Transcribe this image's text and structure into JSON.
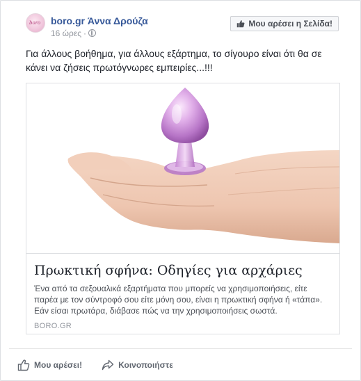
{
  "post": {
    "page_name": "boro.gr Άννα Δρούζα",
    "avatar_text": "boro",
    "time": "16 ώρες",
    "separator": "·",
    "like_page_label": "Μου αρέσει η Σελίδα!",
    "text": "Για άλλους βοήθημα, για άλλους εξάρτημα, το σίγουρο είναι ότι θα σε κάνει να ζήσεις πρωτόγνωρες εμπειρίες...!!!"
  },
  "link": {
    "title": "Πρωκτική σφήνα: Οδηγίες για αρχάριες",
    "description": "Ένα από τα σεξουαλικά εξαρτήματα που μπορείς να χρησιμοποιήσεις, είτε παρέα με τον σύντροφό σου είτε μόνη σου, είναι η πρωκτική σφήνα ή «τάπα». Εάν είσαι πρωτάρα, διάβασε πώς να την χρησιμοποιήσεις σωστά.",
    "domain": "BORO.GR"
  },
  "actions": {
    "like_label": "Μου αρέσει!",
    "share_label": "Κοινοποιήστε"
  },
  "colors": {
    "link_blue": "#365899",
    "meta_gray": "#90949c",
    "plug_purple": "#c98fd6"
  },
  "icons": [
    "thumbs-up-icon",
    "globe-icon",
    "share-arrow-icon"
  ]
}
